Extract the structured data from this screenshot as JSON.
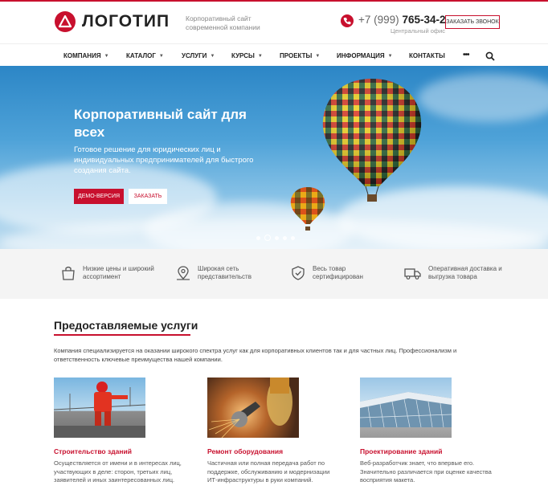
{
  "header": {
    "logo_text": "ЛОГОТИП",
    "tagline": "Корпоративный сайт современной компании",
    "phone_prefix": "+7 (999)",
    "phone_number": "765-34-21",
    "office_label": "Центральный офис",
    "callback_label": "ЗАКАЗАТЬ ЗВОНОК"
  },
  "nav": {
    "items": [
      {
        "label": "КОМПАНИЯ"
      },
      {
        "label": "КАТАЛОГ"
      },
      {
        "label": "УСЛУГИ"
      },
      {
        "label": "КУРСЫ"
      },
      {
        "label": "ПРОЕКТЫ"
      },
      {
        "label": "ИНФОРМАЦИЯ"
      },
      {
        "label": "КОНТАКТЫ"
      }
    ],
    "more_label": "•••"
  },
  "hero": {
    "title": "Корпоративный сайт для всех",
    "subtitle": "Готовое решение для юридических лиц и индивидуальных предпринимателей для быстрого создания сайта.",
    "demo_label": "ДЕМО-ВЕРСИЯ",
    "order_label": "ЗАКАЗАТЬ",
    "slides_total": 5,
    "slide_active": 2
  },
  "features": [
    {
      "icon": "bag-icon",
      "text": "Низкие цены и широкий ассортимент"
    },
    {
      "icon": "map-pin-icon",
      "text": "Широкая сеть представительств"
    },
    {
      "icon": "shield-check-icon",
      "text": "Весь товар сертифицирован"
    },
    {
      "icon": "truck-icon",
      "text": "Оперативная доставка и выгрузка товара"
    }
  ],
  "services": {
    "title": "Предоставляемые услуги",
    "description": "Компания специализируется на оказании широкого спектра услуг как для корпоративных клиентов так и для частных лиц. Профессионализм и ответственность ключевые преимущества нашей компании.",
    "items": [
      {
        "name": "Строительство зданий",
        "text": "Осуществляется от имени и в интересах лиц, участвующих в деле: сторон, третьих лиц, заявителей и иных заинтересованных лиц."
      },
      {
        "name": "Ремонт оборудования",
        "text": "Частичная или полная передача работ по поддержке, обслуживанию и модернизации ИТ-инфраструктуры в руки компаний."
      },
      {
        "name": "Проектирование зданий",
        "text": "Веб-разработчик знает, что впервые его. Значительно различается при оценке качества восприятия макета."
      }
    ]
  },
  "colors": {
    "accent": "#c8102e",
    "feature_bg": "#f4f4f4"
  }
}
